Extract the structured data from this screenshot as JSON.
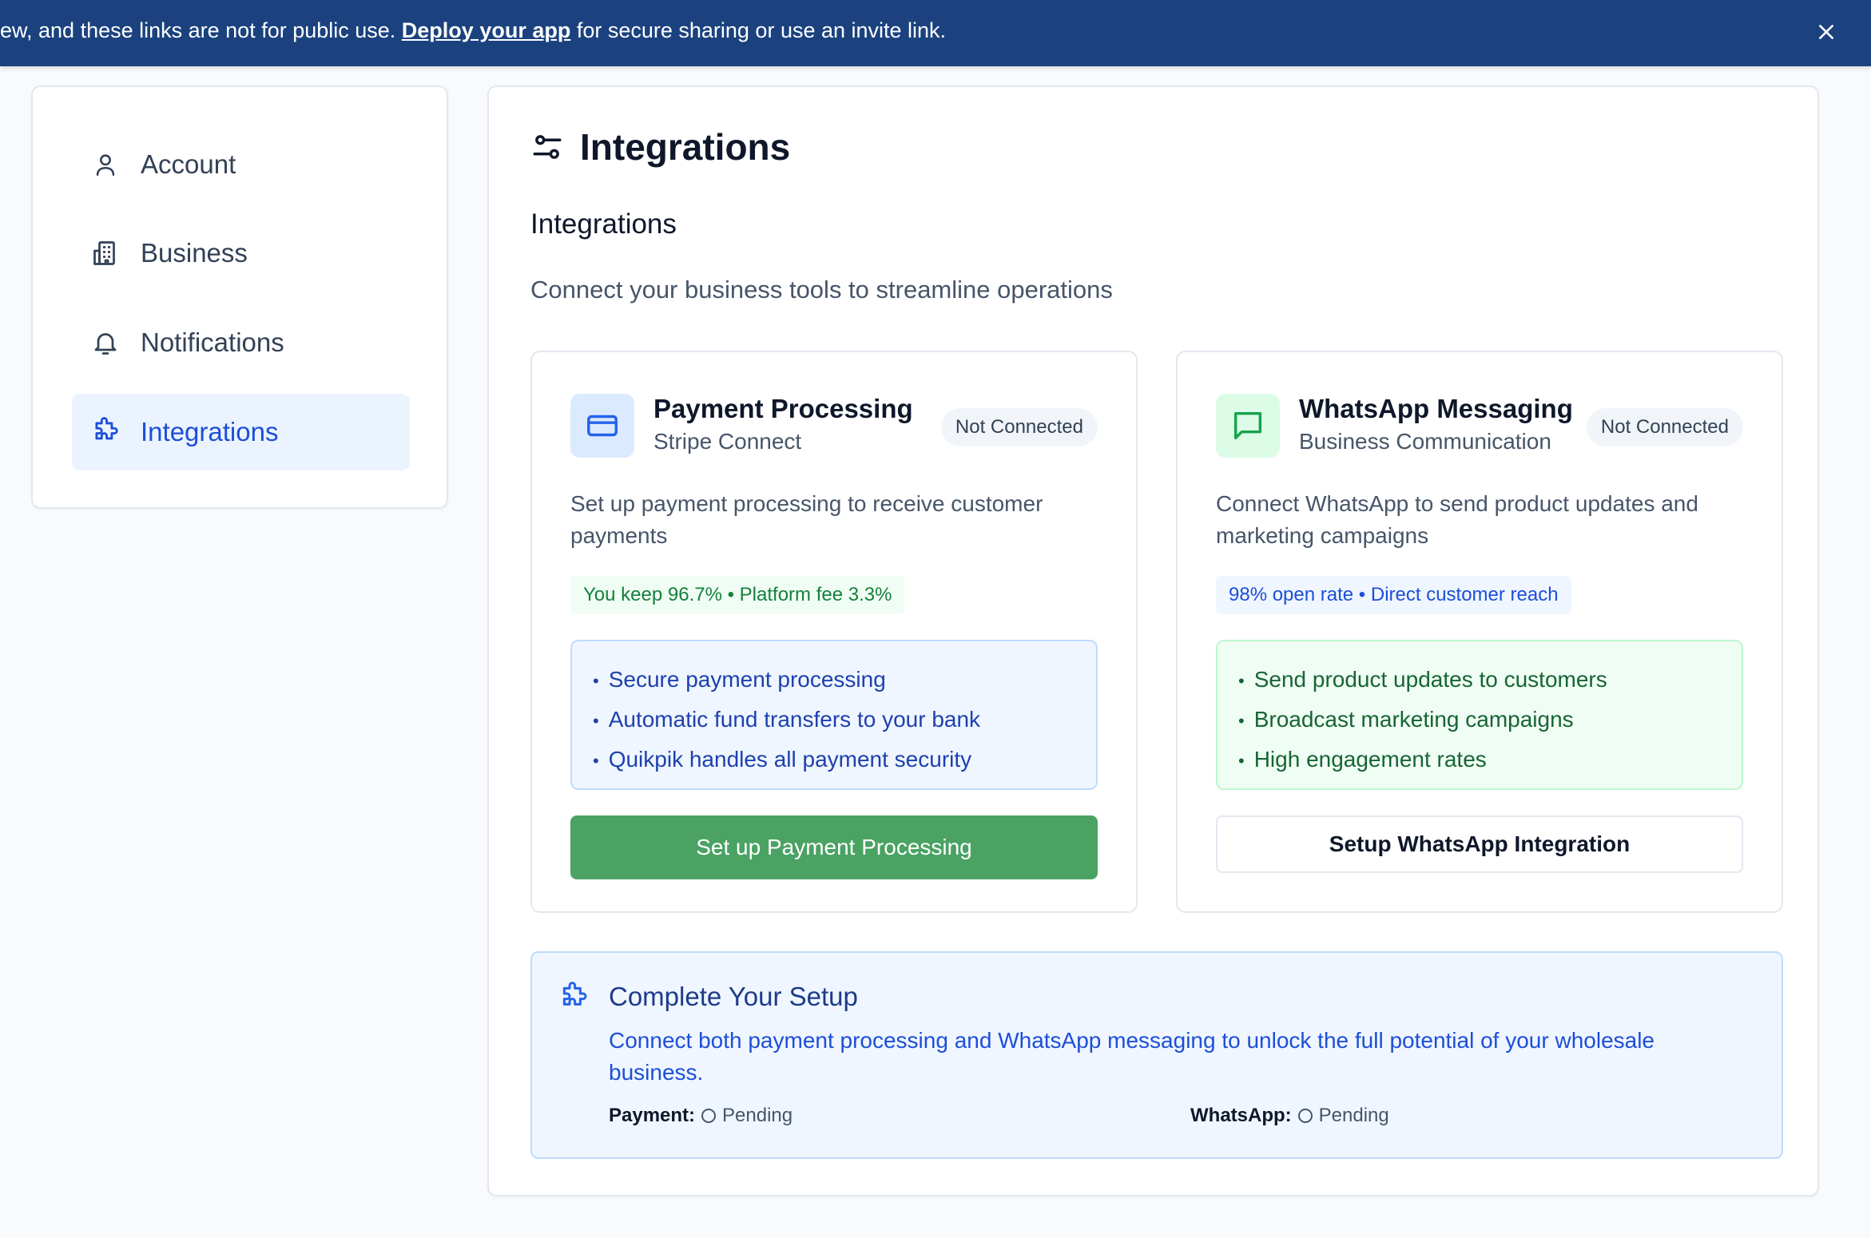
{
  "banner": {
    "text_before": "ew, and these links are not for public use. ",
    "link": "Deploy your app",
    "text_after": " for secure sharing or use an invite link."
  },
  "sidebar": {
    "items": [
      {
        "label": "Account",
        "icon": "user-icon"
      },
      {
        "label": "Business",
        "icon": "building-icon"
      },
      {
        "label": "Notifications",
        "icon": "bell-icon"
      },
      {
        "label": "Integrations",
        "icon": "puzzle-icon",
        "active": true
      }
    ]
  },
  "main": {
    "title": "Integrations",
    "section_title": "Integrations",
    "section_subtitle": "Connect your business tools to streamline operations"
  },
  "cards": {
    "payment": {
      "title": "Payment Processing",
      "subtitle": "Stripe Connect",
      "status": "Not Connected",
      "description": "Set up payment processing to receive customer payments",
      "pill": "You keep 96.7% • Platform fee 3.3%",
      "features": [
        "Secure payment processing",
        "Automatic fund transfers to your bank",
        "Quikpik handles all payment security"
      ],
      "button": "Set up Payment Processing"
    },
    "whatsapp": {
      "title": "WhatsApp Messaging",
      "subtitle": "Business Communication",
      "status": "Not Connected",
      "description": "Connect WhatsApp to send product updates and marketing campaigns",
      "pill": "98% open rate • Direct customer reach",
      "features": [
        "Send product updates to customers",
        "Broadcast marketing campaigns",
        "High engagement rates"
      ],
      "button": "Setup WhatsApp Integration"
    }
  },
  "setup": {
    "title": "Complete Your Setup",
    "description": "Connect both payment processing and WhatsApp messaging to unlock the full potential of your wholesale business.",
    "payment_label": "Payment:",
    "payment_status": "Pending",
    "whatsapp_label": "WhatsApp:",
    "whatsapp_status": "Pending"
  },
  "colors": {
    "banner": "#1b427f",
    "accent": "#1d4ed8",
    "primary_button": "#4aa263"
  }
}
